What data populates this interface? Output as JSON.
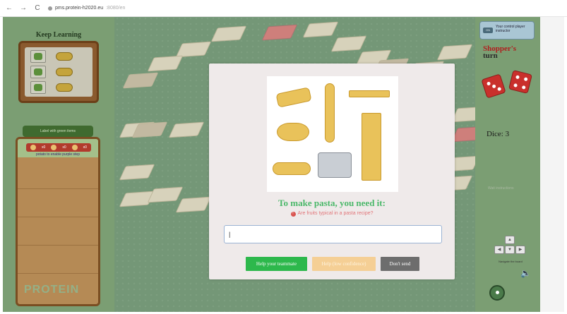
{
  "browser": {
    "back_icon": "←",
    "forward_icon": "→",
    "reload_icon": "C",
    "url_host": "pms.protein-h2020.eu",
    "url_path": ":8080/en"
  },
  "left_panel": {
    "title": "Keep Learning",
    "collect_label": "Label with green items",
    "collected_counts": [
      "x0",
      "x0",
      "x0"
    ],
    "collected_note": "potato to enable purple step",
    "logo_text": "PROTEIN"
  },
  "right_panel": {
    "control_tag": "ON",
    "control_text": "Your control player instructor",
    "shoppers_title": "Shopper's",
    "turn_label": "turn",
    "dice_label": "Dice: 3",
    "faded_text": "Wait instructions",
    "navigate_label": "Navigate the board",
    "speaker_icon": "🔈",
    "keys": {
      "up": "▲",
      "left": "◀",
      "down": "▼",
      "right": "▶"
    }
  },
  "modal": {
    "question": "To make pasta, you need it:",
    "hint": "Are fruits typical in a pasta recipe?",
    "hint_icon": "!",
    "answer_value": "|",
    "buttons": {
      "help_teammate": "Help your teammate",
      "help_confidence": "Help (low confidence)",
      "dont_send": "Don't send"
    }
  },
  "colors": {
    "board_green": "#2e6a33",
    "panel_green": "#7b9e73",
    "question_green": "#4bb86a",
    "hint_red": "#e2767a",
    "help_button": "#2db84c",
    "confidence_button": "#f5cf95",
    "dont_send_button": "#6d6d6d",
    "shoppers_red": "#b01e1e"
  }
}
